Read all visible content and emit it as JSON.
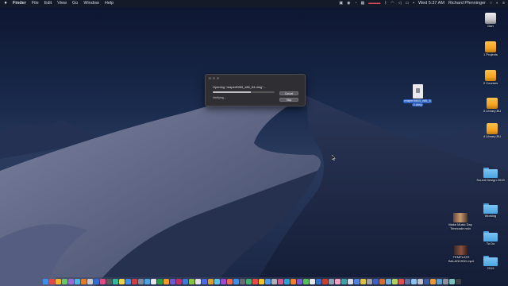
{
  "menubar": {
    "app_name": "Finder",
    "menus": [
      "File",
      "Edit",
      "View",
      "Go",
      "Window",
      "Help"
    ],
    "clock": "Wed 5:37 AM",
    "user": "Richard Pfenninger"
  },
  "dialog": {
    "title": "Opening “reaper5983_x86_64.dmg”...",
    "status": "Verifying...",
    "progress": 0.62,
    "cancel_label": "Cancel",
    "skip_label": "Skip"
  },
  "desktop_file": {
    "label_line1": "reaper5983_x86_6",
    "label_line2": "4.dmg"
  },
  "sidebar_icons": [
    {
      "label": "Dan",
      "kind": "drive"
    },
    {
      "label": "1 Projects",
      "kind": "drive-orange"
    },
    {
      "label": "2 Courses",
      "kind": "drive-orange"
    },
    {
      "label": "3 Library BU",
      "kind": "drive-orange"
    },
    {
      "label": "4 Library BU",
      "kind": "drive-orange"
    },
    {
      "label": "Sound Design 2019",
      "kind": "folder"
    },
    {
      "label": "Working",
      "kind": "folder"
    },
    {
      "label": "To Do",
      "kind": "folder"
    },
    {
      "label": "2019",
      "kind": "folder"
    }
  ],
  "video_files": [
    {
      "label_line1": "Make Music Day",
      "label_line2": "Timecode.m4v"
    },
    {
      "label_line1": "TEMPLATE",
      "label_line2": "BALANCING.mp4"
    }
  ],
  "dock_colors": [
    "#3d8fe8",
    "#e24a4a",
    "#f2b134",
    "#6fc36a",
    "#9a6bd8",
    "#4cb4e0",
    "#e27a2c",
    "#c8c8cc",
    "#2e6cd1",
    "#e24a84",
    "#5a5a5e",
    "#35b8a0",
    "#f0d24a",
    "#3d8fe8",
    "#d04040",
    "#7a8aa0",
    "#4aa3e0",
    "#e8e8ec",
    "#2a9a4a",
    "#f29a2a",
    "#6b5bd0",
    "#c03060",
    "#3a7ad8",
    "#8ac040",
    "#e0e0e4",
    "#4a6ae8",
    "#d8a030",
    "#5ac0e8",
    "#a04ad0",
    "#e86a4a",
    "#3d8fe8",
    "#6a6a70",
    "#40b070",
    "#e84a4a",
    "#f2c230",
    "#4a9ae8",
    "#b0b0b8",
    "#d05a8a",
    "#2ea0d0",
    "#f08030",
    "#7a5ad0",
    "#58c058",
    "#e8e8ec",
    "#3070c8",
    "#c8402a",
    "#8aa0b8",
    "#f0a0c0",
    "#40a0a8",
    "#d8d8e0",
    "#5080e0",
    "#e0c040",
    "#a0a0a8",
    "#4060c0",
    "#d07030",
    "#70b0e0",
    "#b0d060",
    "#e05050",
    "#6070a0",
    "#90c0f0",
    "#c0c0c8",
    "#3a5aa0",
    "#e89a3a",
    "#5aa0d0",
    "#9090a0",
    "#7ac0c0",
    "#404048"
  ]
}
